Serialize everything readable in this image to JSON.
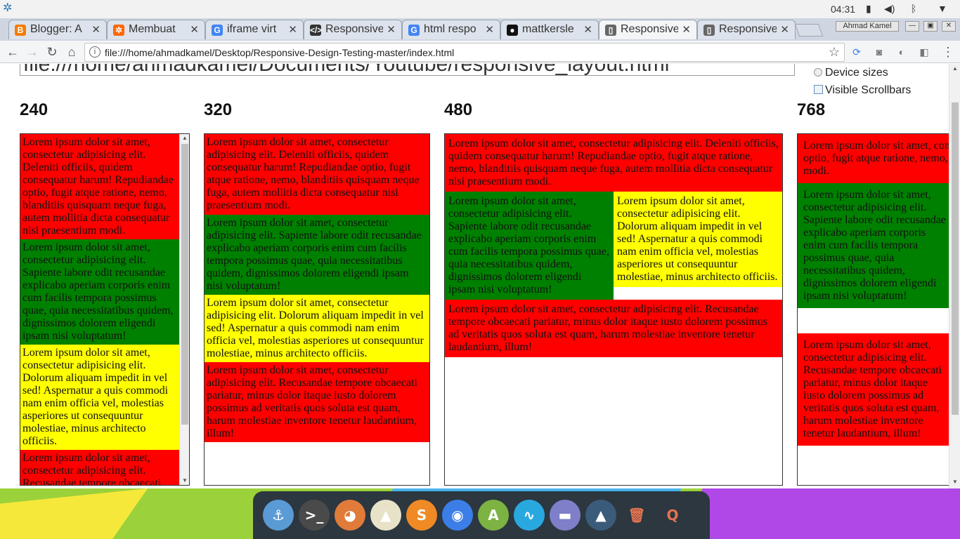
{
  "system": {
    "clock": "04:31",
    "icons": [
      "battery-icon",
      "volume-icon",
      "bluetooth-icon",
      "wifi-icon"
    ]
  },
  "tabs": [
    {
      "title": "Blogger: A",
      "icon": "blogger-icon",
      "color": "#f57c00",
      "glyph": "B",
      "active": false
    },
    {
      "title": "Membuat",
      "icon": "generic-site-icon",
      "color": "#ff6600",
      "glyph": "✲",
      "active": false
    },
    {
      "title": "iframe virt",
      "icon": "google-icon",
      "color": "#4285f4",
      "glyph": "G",
      "active": false
    },
    {
      "title": "Responsive",
      "icon": "code-icon",
      "color": "#333333",
      "glyph": "</>",
      "active": false
    },
    {
      "title": "html respo",
      "icon": "google-icon",
      "color": "#4285f4",
      "glyph": "G",
      "active": false
    },
    {
      "title": "mattkersle",
      "icon": "github-icon",
      "color": "#111111",
      "glyph": "●",
      "active": false
    },
    {
      "title": "Responsive",
      "icon": "document-icon",
      "color": "#666666",
      "glyph": "▯",
      "active": true
    },
    {
      "title": "Responsive",
      "icon": "document-icon",
      "color": "#666666",
      "glyph": "▯",
      "active": false
    }
  ],
  "window": {
    "user": "Ahmad Kamel",
    "min_glyph": "—",
    "max_glyph": "▣",
    "close_glyph": "✕"
  },
  "toolbar": {
    "url": "file:///home/ahmadkamel/Desktop/Responsive-Design-Testing-master/index.html",
    "back": "←",
    "forward": "→",
    "reload": "↻",
    "home": "⌂",
    "info": "i",
    "star": "☆",
    "menu": "⋮"
  },
  "page": {
    "input_value": "file:///home/ahmadkamel/Documents/Youtube/responsive_layout.html",
    "device_sizes_label": "Device sizes",
    "visible_scrollbars_label": "Visible Scrollbars",
    "columns": [
      "240",
      "320",
      "480",
      "768"
    ]
  },
  "content": {
    "red1": "Lorem ipsum dolor sit amet, consectetur adipisicing elit. Deleniti officiis, quidem consequatur harum! Repudiandae optio, fugit atque ratione, nemo, blanditiis quisquam neque fuga, autem mollitia dicta consequatur nisi praesentium modi.",
    "green": "Lorem ipsum dolor sit amet, consectetur adipisicing elit. Sapiente labore odit recusandae explicabo aperiam corporis enim cum facilis tempora possimus quae, quia necessitatibus quidem, dignissimos dolorem eligendi ipsam nisi voluptatum!",
    "yellow": "Lorem ipsum dolor sit amet, consectetur adipisicing elit. Dolorum aliquam impedit in vel sed! Aspernatur a quis commodi nam enim officia vel, molestias asperiores ut consequuntur molestiae, minus architecto officiis.",
    "red2": "Lorem ipsum dolor sit amet, consectetur adipisicing elit. Recusandae tempore obcaecati pariatur, minus dolor itaque iusto dolorem possimus ad veritatis quos soluta est quam, harum molestiae inventore tenetur laudantium, illum!",
    "f768_red1": "Lorem ipsum dolor sit amet, consectetur adipisicing elit. Deleniti officiis, quidem consequatur harum! Repudiandae optio, fugit atque ratione, nemo, blanditiis quisquam neque fuga, autem mollitia dicta consequatur nisi praesentium modi.",
    "f768_green": "Lorem ipsum dolor sit amet, consectetur adipisicing elit. Sapiente labore odit recusandae explicabo aperiam corporis enim cum facilis tempora possimus quae, quia necessitatibus quidem, dignissimos dolorem eligendi ipsam nisi voluptatum!",
    "f768_red2": "Lorem ipsum dolor sit amet, consectetur adipisicing elit. Recusandae tempore obcaecati pariatur, minus dolor itaque iusto dolorem possimus ad veritatis quos soluta est quam, harum molestiae inventore tenetur laudantium, illum!"
  },
  "dock": [
    {
      "name": "anchor-app-icon",
      "glyph": "⚓",
      "color": "#5b9bd5"
    },
    {
      "name": "terminal-app-icon",
      "glyph": ">_",
      "color": "#4a4a4a"
    },
    {
      "name": "gimp-app-icon",
      "glyph": "◕",
      "color": "#e07b39"
    },
    {
      "name": "inkscape-app-icon",
      "glyph": "▲",
      "color": "#e8e3c8"
    },
    {
      "name": "sublime-app-icon",
      "glyph": "S",
      "color": "#f08a24"
    },
    {
      "name": "chrome-app-icon",
      "glyph": "◉",
      "color": "#3c7ee8"
    },
    {
      "name": "android-studio-app-icon",
      "glyph": "A",
      "color": "#7cb342"
    },
    {
      "name": "monitor-app-icon",
      "glyph": "∿",
      "color": "#29a8e0"
    },
    {
      "name": "files-app-icon",
      "glyph": "▬",
      "color": "#7e7fc8"
    },
    {
      "name": "image-viewer-app-icon",
      "glyph": "▲",
      "color": "#3b5b7a"
    },
    {
      "name": "trash-app-icon",
      "glyph": "🗑",
      "color": "transparent"
    },
    {
      "name": "search-app-icon",
      "glyph": "Q",
      "color": "transparent"
    }
  ]
}
